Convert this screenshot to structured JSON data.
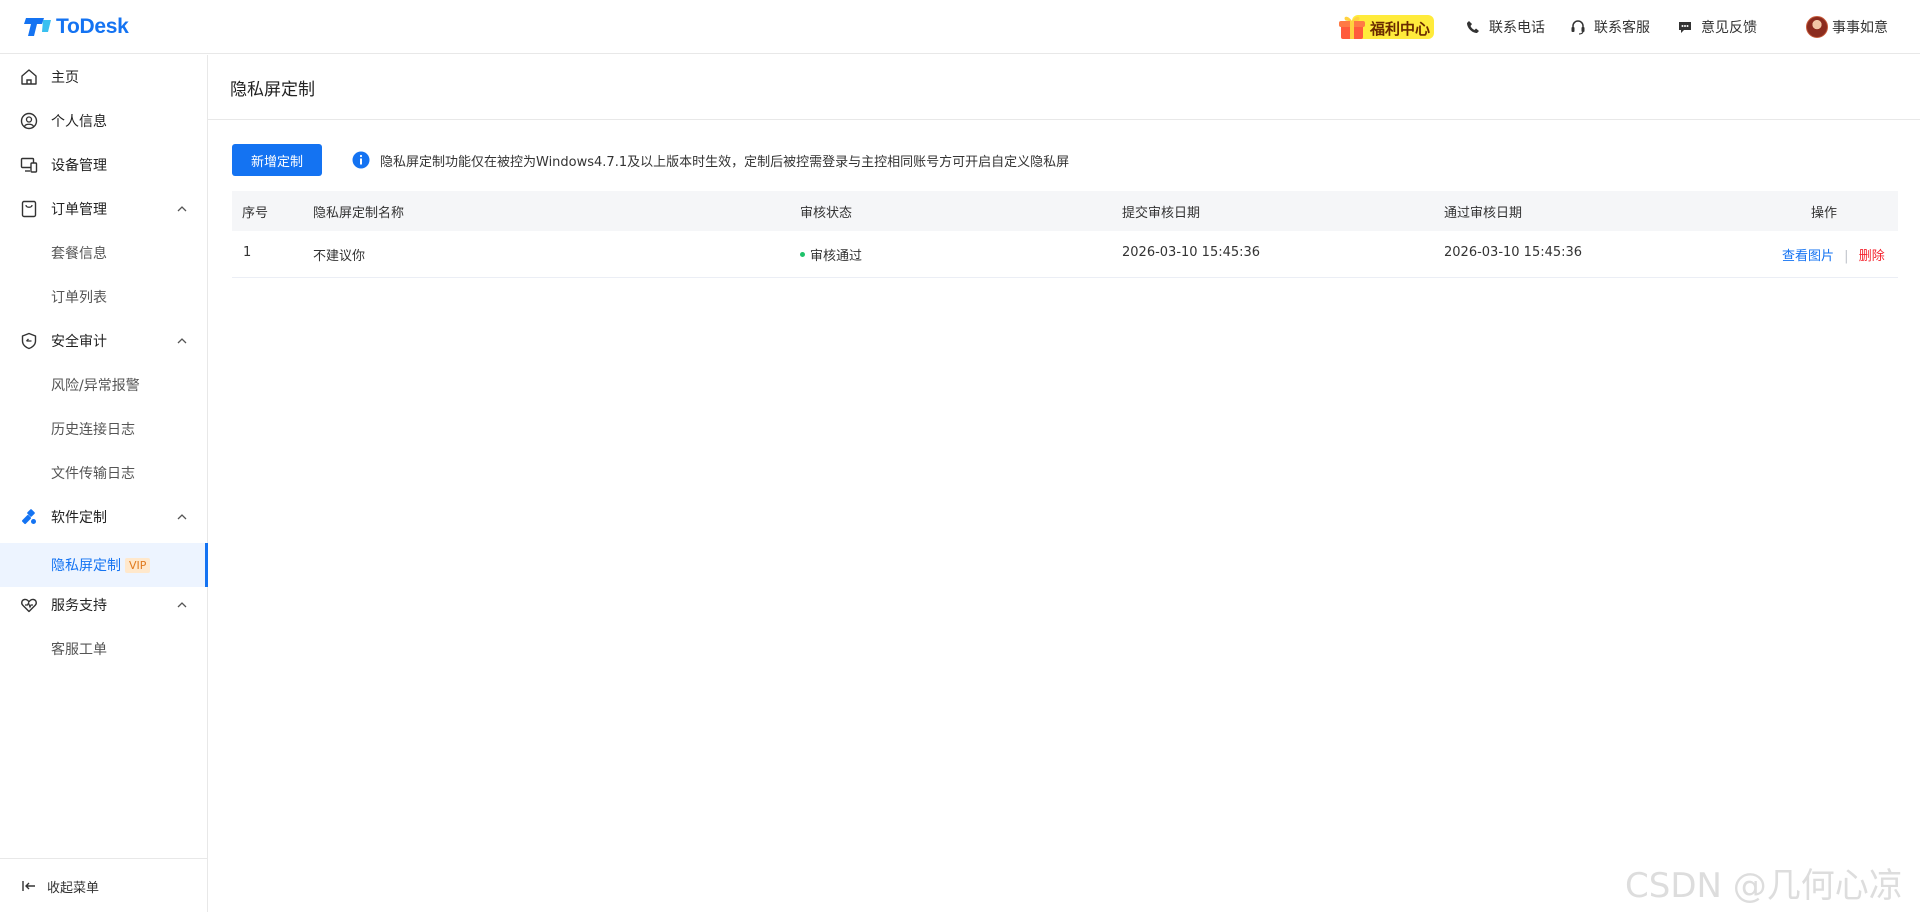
{
  "header": {
    "logo_text": "ToDesk",
    "welfare_label": "福利中心",
    "phone_label": "联系电话",
    "service_label": "联系客服",
    "feedback_label": "意见反馈",
    "user_name": "事事如意"
  },
  "sidebar": {
    "items": [
      {
        "label": "主页",
        "icon": "home-icon"
      },
      {
        "label": "个人信息",
        "icon": "user-icon"
      },
      {
        "label": "设备管理",
        "icon": "device-icon"
      },
      {
        "label": "订单管理",
        "icon": "order-icon",
        "children": [
          "套餐信息",
          "订单列表"
        ]
      },
      {
        "label": "安全审计",
        "icon": "shield-icon",
        "children": [
          "风险/异常报警",
          "历史连接日志",
          "文件传输日志"
        ]
      },
      {
        "label": "软件定制",
        "icon": "customize-icon",
        "children": [
          "隐私屏定制"
        ]
      },
      {
        "label": "服务支持",
        "icon": "support-icon",
        "children": [
          "客服工单"
        ]
      }
    ],
    "active_sub": "隐私屏定制",
    "vip_badge": "VIP",
    "collapse_label": "收起菜单"
  },
  "main": {
    "page_title": "隐私屏定制",
    "add_button_label": "新增定制",
    "notice_text": "隐私屏定制功能仅在被控为Windows4.7.1及以上版本时生效，定制后被控需登录与主控相同账号方可开启自定义隐私屏",
    "table": {
      "headers": [
        "序号",
        "隐私屏定制名称",
        "审核状态",
        "提交审核日期",
        "通过审核日期",
        "操作"
      ],
      "rows": [
        {
          "index": "1",
          "name": "不建议你",
          "status": "审核通过",
          "submit_date": "2026-03-10 15:45:36",
          "approve_date": "2026-03-10 15:45:36",
          "op_view": "查看图片",
          "op_sep": "|",
          "op_delete": "删除"
        }
      ]
    }
  },
  "watermark": "CSDN @几何心凉",
  "colors": {
    "accent": "#1473f2",
    "danger": "#f5222d",
    "success": "#1ec26a",
    "welfare_bg": "#ffeb3b"
  }
}
